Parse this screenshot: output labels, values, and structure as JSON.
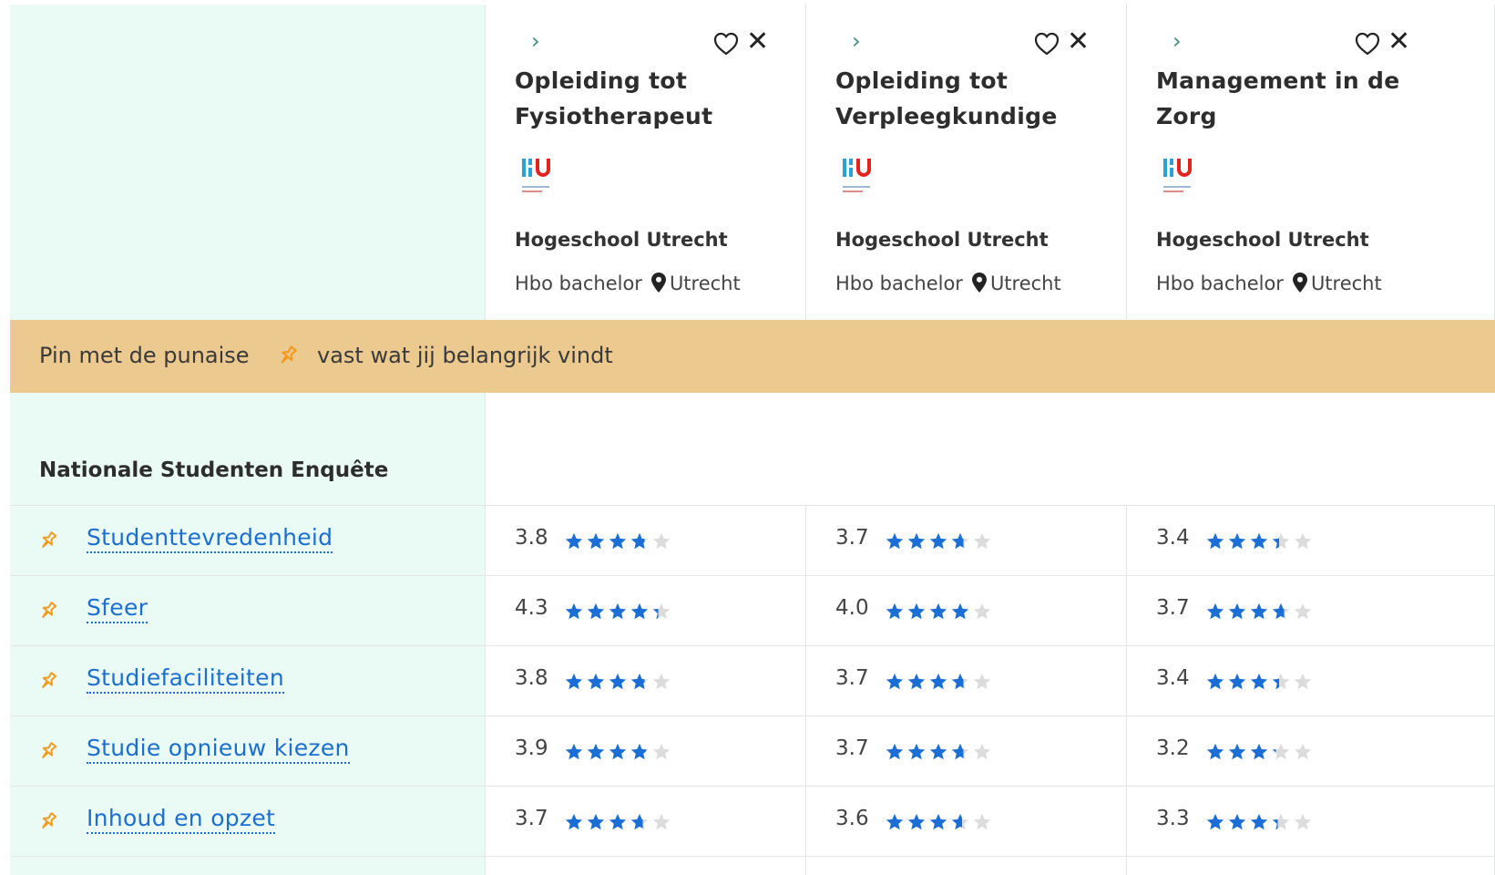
{
  "programs": [
    {
      "title": "Opleiding tot Fysiotherapeut",
      "school": "Hogeschool Utrecht",
      "level": "Hbo bachelor",
      "city": "Utrecht"
    },
    {
      "title": "Opleiding tot Verpleegkundige",
      "school": "Hogeschool Utrecht",
      "level": "Hbo bachelor",
      "city": "Utrecht"
    },
    {
      "title": "Management in de Zorg",
      "school": "Hogeschool Utrecht",
      "level": "Hbo bachelor",
      "city": "Utrecht"
    }
  ],
  "banner": {
    "before": "Pin met de punaise",
    "after": "vast wat jij belangrijk vindt"
  },
  "section": {
    "title": "Nationale Studenten Enquête"
  },
  "rows": [
    {
      "label": "Studenttevredenheid",
      "scores": [
        "3.8",
        "3.7",
        "3.4"
      ]
    },
    {
      "label": "Sfeer",
      "scores": [
        "4.3",
        "4.0",
        "3.7"
      ]
    },
    {
      "label": "Studiefaciliteiten",
      "scores": [
        "3.8",
        "3.7",
        "3.4"
      ]
    },
    {
      "label": "Studie opnieuw kiezen",
      "scores": [
        "3.9",
        "3.7",
        "3.2"
      ]
    },
    {
      "label": "Inhoud en opzet",
      "scores": [
        "3.7",
        "3.6",
        "3.3"
      ]
    }
  ],
  "colors": {
    "mint": "#e9fbf4",
    "banner": "#ecc98e",
    "link": "#1c6fd1",
    "star": "#1a6ed6",
    "star_empty": "#dcdcdc",
    "pin": "#f39a1e"
  },
  "icons": {
    "chevron": "chevron-right-icon",
    "favorite": "heart-icon",
    "remove": "close-icon",
    "location": "location-pin-icon",
    "pin": "pushpin-icon",
    "star": "star-icon"
  }
}
